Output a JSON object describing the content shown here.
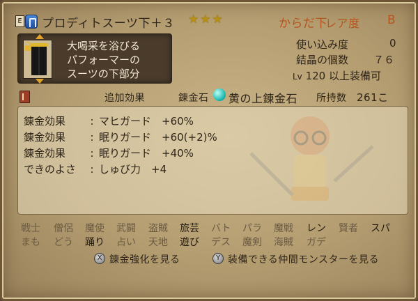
{
  "header": {
    "equip_marker": "E",
    "item_name": "プロディトスーツ下＋３",
    "stars": "★★★",
    "category": "からだ下",
    "rarity_label": "レア度",
    "rarity": "B"
  },
  "item": {
    "description": [
      "大喝采を浴びる",
      "パフォーマーの",
      "スーツの下部分"
    ]
  },
  "stats": {
    "usage_label": "使い込み度",
    "usage_value": "0",
    "crystal_label": "結晶の個数",
    "crystal_value": "７６",
    "level_prefix": "Lv",
    "level_value": "120",
    "level_suffix": "以上装備可"
  },
  "bar": {
    "extra_effect_label": "追加効果",
    "alchemy_stone_label": "錬金石",
    "stone_name": "黄の上錬金石",
    "owned_label": "所持数",
    "owned_value": "261こ"
  },
  "effects": [
    {
      "label": "錬金効果",
      "value": "マヒガード　+60%"
    },
    {
      "label": "錬金効果",
      "value": "眠りガード　+60(+2)%"
    },
    {
      "label": "錬金効果",
      "value": "眠りガード　+40%"
    },
    {
      "label": "できのよさ",
      "value": "しゅび力　+4"
    }
  ],
  "jobs_row1": [
    {
      "name": "戦士",
      "enabled": false
    },
    {
      "name": "僧侶",
      "enabled": false
    },
    {
      "name": "魔使",
      "enabled": false
    },
    {
      "name": "武闘",
      "enabled": false
    },
    {
      "name": "盗賊",
      "enabled": false
    },
    {
      "name": "旅芸",
      "enabled": true
    },
    {
      "name": "バト",
      "enabled": false
    },
    {
      "name": "パラ",
      "enabled": false
    },
    {
      "name": "魔戦",
      "enabled": false
    },
    {
      "name": "レン",
      "enabled": true
    },
    {
      "name": "賢者",
      "enabled": false
    },
    {
      "name": "スパ",
      "enabled": true
    }
  ],
  "jobs_row2": [
    {
      "name": "まも",
      "enabled": false
    },
    {
      "name": "どう",
      "enabled": false
    },
    {
      "name": "踊り",
      "enabled": true
    },
    {
      "name": "占い",
      "enabled": false
    },
    {
      "name": "天地",
      "enabled": false
    },
    {
      "name": "遊び",
      "enabled": true
    },
    {
      "name": "デス",
      "enabled": false
    },
    {
      "name": "魔剣",
      "enabled": false
    },
    {
      "name": "海賊",
      "enabled": false
    },
    {
      "name": "ガデ",
      "enabled": false
    }
  ],
  "footer": {
    "x_button": "X",
    "x_label": "錬金強化を見る",
    "y_button": "Y",
    "y_label": "装備できる仲間モンスターを見る"
  }
}
